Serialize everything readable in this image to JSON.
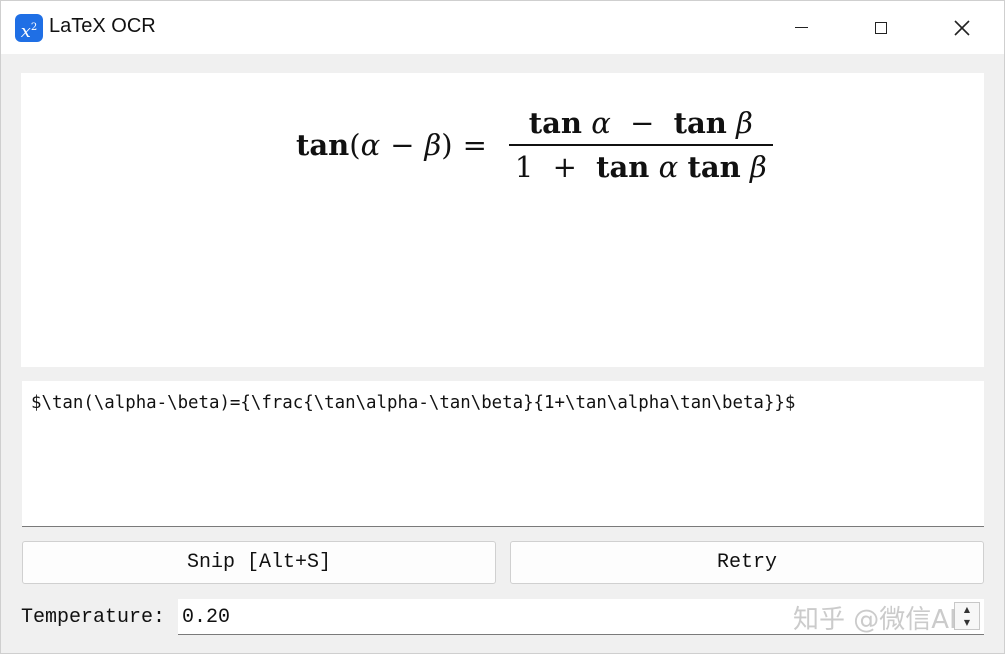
{
  "window": {
    "title": "LaTeX OCR",
    "icon": "x-squared-app-icon",
    "controls": [
      "minimize-icon",
      "maximize-icon",
      "close-icon"
    ]
  },
  "preview": {
    "formula": {
      "lhs_fn": "tan",
      "lhs_open": "(",
      "alpha": "α",
      "minus": "−",
      "beta": "β",
      "lhs_close": ")",
      "equals": "=",
      "num_tan1": "tan",
      "num_alpha": "α",
      "num_minus": "−",
      "num_tan2": "tan",
      "num_beta": "β",
      "den_one": "1",
      "den_plus": "+",
      "den_tan1": "tan",
      "den_alpha": "α",
      "den_tan2": "tan",
      "den_beta": "β"
    }
  },
  "latex_output": "$\\tan(\\alpha-\\beta)={\\frac{\\tan\\alpha-\\tan\\beta}{1+\\tan\\alpha\\tan\\beta}}$",
  "buttons": {
    "snip": "Snip [Alt+S]",
    "retry": "Retry"
  },
  "temperature": {
    "label": "Temperature:",
    "value": "0.20"
  },
  "watermark": "知乎 @微信AI"
}
